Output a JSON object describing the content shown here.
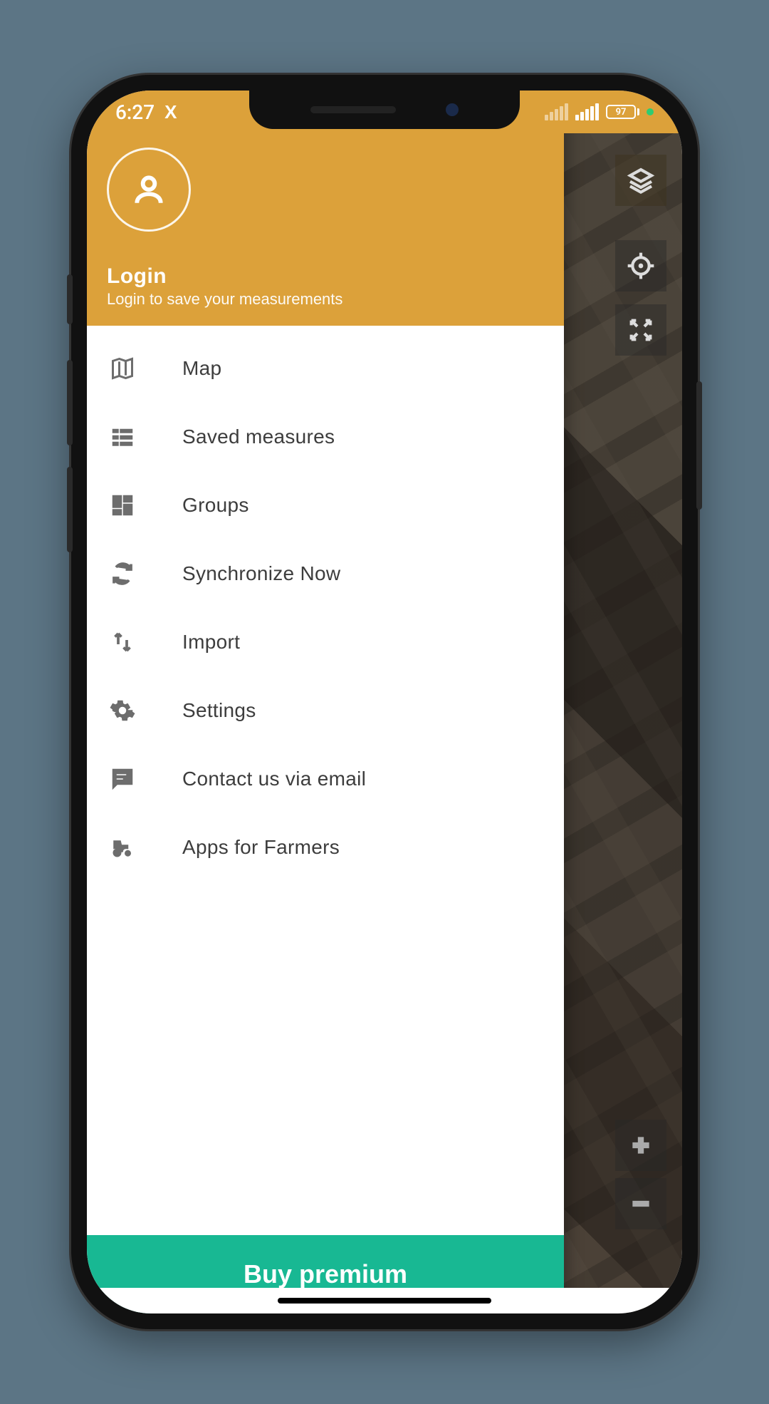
{
  "status": {
    "time": "6:27",
    "app_indicator": "X",
    "battery": "97"
  },
  "header": {
    "title": "Login",
    "subtitle": "Login to save your measurements"
  },
  "menu": {
    "items": [
      {
        "icon": "map-icon",
        "label": "Map"
      },
      {
        "icon": "list-icon",
        "label": "Saved measures"
      },
      {
        "icon": "dashboard-icon",
        "label": "Groups"
      },
      {
        "icon": "sync-icon",
        "label": "Synchronize Now"
      },
      {
        "icon": "import-icon",
        "label": "Import"
      },
      {
        "icon": "gear-icon",
        "label": "Settings"
      },
      {
        "icon": "chat-icon",
        "label": "Contact us via email"
      },
      {
        "icon": "tractor-icon",
        "label": "Apps for Farmers"
      }
    ]
  },
  "footer": {
    "premium_label": "Buy premium"
  },
  "colors": {
    "header_bg": "#dca13a",
    "premium_bg": "#18b893",
    "page_bg": "#5c7585",
    "icon_color": "#6d6d6d"
  }
}
